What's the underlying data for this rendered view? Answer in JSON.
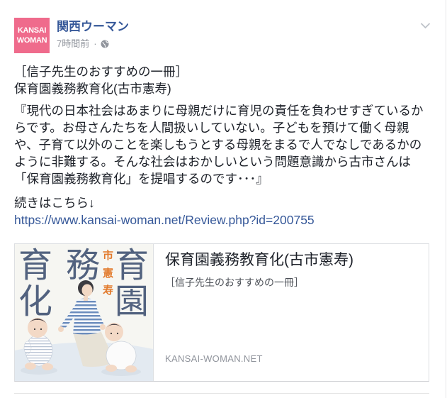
{
  "post": {
    "page_name": "関西ウーマン",
    "timestamp": "7時間前",
    "meta_separator": "·",
    "privacy_icon": "globe-icon",
    "menu_icon": "chevron-down-icon",
    "avatar": {
      "logo_lines": [
        "KANSAI",
        "WOMAN"
      ]
    },
    "text": {
      "intro_lines": [
        "［信子先生のおすすめの一冊］",
        "保育園義務教育化(古市憲寿)"
      ],
      "quote_lines": [
        "『現代の日本社会はあまりに母親だけに育児の責任を負わせすぎているか",
        "らです。お母さんたちを人間扱いしていない。子どもを預けて働く母親",
        "や、子育て以外のことを楽しもうとする母親をまるで人でなしであるかの",
        "ように非難する。そんな社会はおかしいという問題意識から古市さんは",
        "「保育園義務教育化」を提唱するのです･･･』"
      ],
      "more_label": "続きはこちら↓",
      "link_text": "https://www.kansai-woman.net/Review.php?id=200755"
    },
    "link_card": {
      "title": "保育園義務教育化(古市憲寿)",
      "description": "［信子先生のおすすめの一冊］",
      "domain": "KANSAI-WOMAN.NET",
      "cover": {
        "title_glyphs": [
          "育",
          "務",
          "育",
          "化",
          "園"
        ],
        "author_glyphs": [
          "市",
          "憲",
          "寿"
        ]
      }
    }
  },
  "colors": {
    "brand_pink": "#ef6b8c",
    "link_blue": "#365899",
    "text": "#1d2129",
    "meta_gray": "#90949c",
    "cover_ink": "#52627f",
    "cover_orange": "#e27a2c"
  }
}
